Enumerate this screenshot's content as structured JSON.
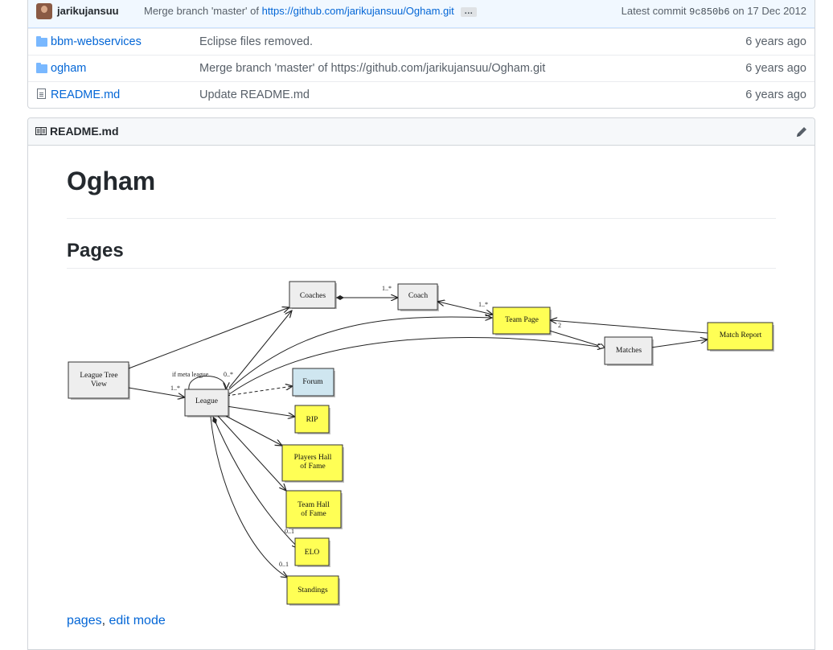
{
  "commit": {
    "author": "jarikujansuu",
    "message_prefix": "Merge branch 'master' of ",
    "message_link": "https://github.com/jarikujansuu/Ogham.git",
    "ellipsis": "…",
    "latest_label": "Latest commit",
    "sha": "9c850b6",
    "date": "on 17 Dec 2012"
  },
  "files": [
    {
      "name": "bbm-webservices",
      "type": "folder",
      "message": "Eclipse files removed.",
      "age": "6 years ago"
    },
    {
      "name": "ogham",
      "type": "folder",
      "message": "Merge branch 'master' of https://github.com/jarikujansuu/Ogham.git",
      "age": "6 years ago"
    },
    {
      "name": "README.md",
      "type": "file",
      "message": "Update README.md",
      "age": "6 years ago"
    }
  ],
  "readme": {
    "header_title": "README.md",
    "h1": "Ogham",
    "h2": "Pages",
    "links": {
      "pages": "pages",
      "separator": ", ",
      "edit_mode": "edit mode"
    }
  },
  "diagram": {
    "nodes": {
      "coaches": "Coaches",
      "coach": "Coach",
      "team_page": "Team Page",
      "match_report": "Match Report",
      "matches": "Matches",
      "league_tree_1": "League Tree",
      "league_tree_2": "View",
      "league": "League",
      "forum": "Forum",
      "rip": "RIP",
      "players_hof_1": "Players Hall",
      "players_hof_2": "of Fame",
      "team_hof_1": "Team Hall",
      "team_hof_2": "of Fame",
      "elo": "ELO",
      "standings": "Standings"
    },
    "labels": {
      "coaches_coach": "1..*",
      "coach_team": "1..*",
      "team_matches": "2",
      "meta": "if meta league",
      "tree_league": "1..*",
      "league_self": "0..*",
      "elo": "0..1",
      "standings": "0..1"
    }
  }
}
